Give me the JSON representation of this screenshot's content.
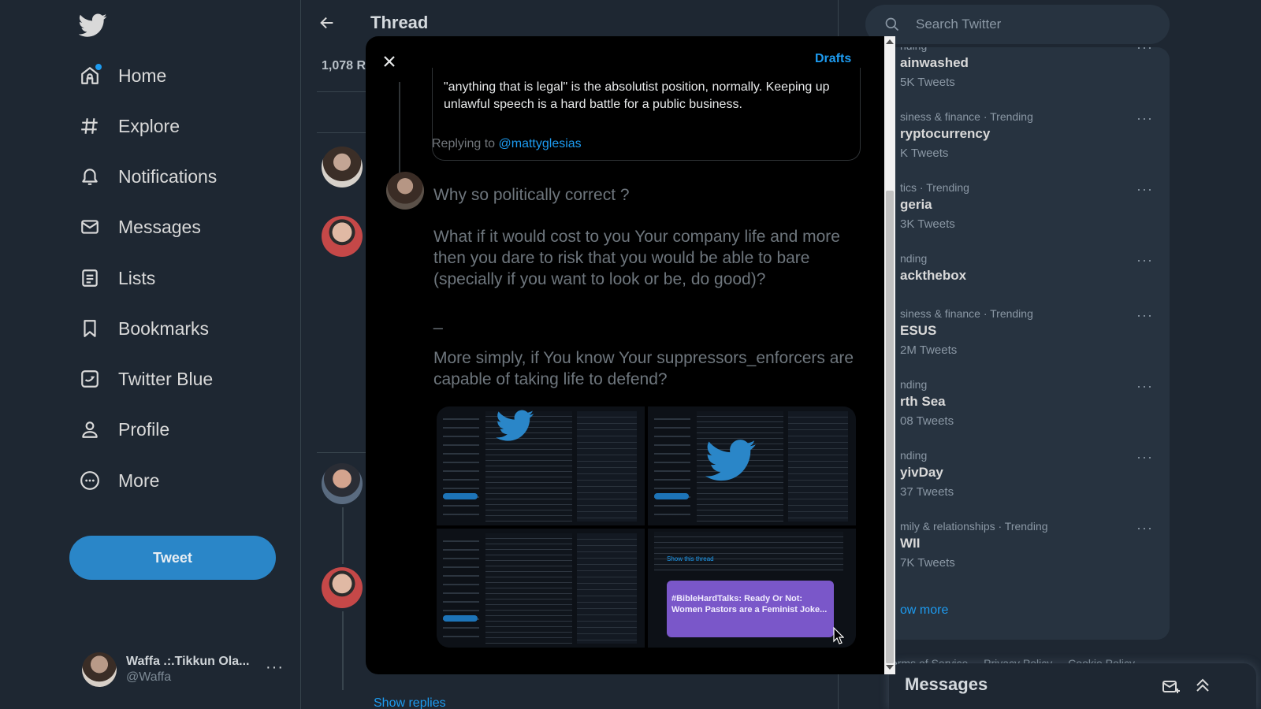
{
  "nav": {
    "items": [
      {
        "label": "Home",
        "icon": "home-icon"
      },
      {
        "label": "Explore",
        "icon": "hashtag-icon"
      },
      {
        "label": "Notifications",
        "icon": "bell-icon"
      },
      {
        "label": "Messages",
        "icon": "envelope-icon"
      },
      {
        "label": "Lists",
        "icon": "list-icon"
      },
      {
        "label": "Bookmarks",
        "icon": "bookmark-icon"
      },
      {
        "label": "Twitter Blue",
        "icon": "twitter-blue-icon"
      },
      {
        "label": "Profile",
        "icon": "person-icon"
      },
      {
        "label": "More",
        "icon": "more-circle-icon"
      }
    ],
    "tweet_button": "Tweet"
  },
  "account": {
    "display_name": "Waffa .:.Tikkun Ola...",
    "handle": "@Waffa",
    "menu": "···"
  },
  "center": {
    "title": "Thread",
    "stat_fragment": "1,078 R",
    "show_replies": "Show replies"
  },
  "modal": {
    "drafts": "Drafts",
    "quote_text": "\"anything that is legal\" is the absolutist position, normally.  Keeping up unlawful speech is a hard battle for a public business.",
    "replying_prefix": "Replying to ",
    "replying_handle": "@mattyglesias",
    "compose_paragraphs": [
      "Why so politically correct ?",
      "What if it would cost to you Your company life and more then you dare to risk that you would be able to bare (specially if you want to look or be, do good)?",
      "_",
      "More simply, if You know Your suppressors_enforcers are capable of taking life to defend?"
    ],
    "attached_image_promo": "#BibleHardTalks: Ready Or Not: Women Pastors are a Feminist Joke...",
    "attached_image_link": "Show this thread"
  },
  "search": {
    "placeholder": "Search Twitter"
  },
  "trends": [
    {
      "meta": "nding",
      "name": "ainwashed",
      "count": "5K Tweets"
    },
    {
      "meta": "siness & finance · Trending",
      "name": "ryptocurrency",
      "count": "K Tweets"
    },
    {
      "meta": "tics · Trending",
      "name": "geria",
      "count": "3K Tweets"
    },
    {
      "meta": "nding",
      "name": "ackthebox",
      "count": ""
    },
    {
      "meta": "siness & finance · Trending",
      "name": "ESUS",
      "count": "2M Tweets"
    },
    {
      "meta": "nding",
      "name": "rth Sea",
      "count": "08 Tweets"
    },
    {
      "meta": "nding",
      "name": "yivDay",
      "count": "37 Tweets"
    },
    {
      "meta": "mily & relationships · Trending",
      "name": "WII",
      "count": "7K Tweets"
    }
  ],
  "show_more": "ow more",
  "footer_links": [
    "Terms of Service",
    "Privacy Policy",
    "Cookie Policy"
  ],
  "messages_drawer": {
    "title": "Messages"
  },
  "colors": {
    "accent": "#1d9bf0",
    "background": "#1e2732",
    "card": "#273340",
    "modal": "#000000"
  }
}
